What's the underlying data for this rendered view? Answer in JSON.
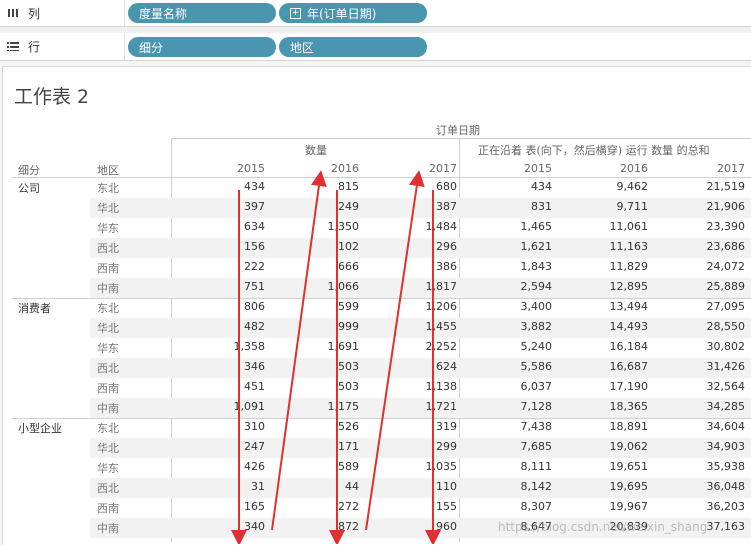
{
  "shelves": {
    "columns": {
      "label": "列",
      "icon": "columns-icon",
      "pills": [
        "度量名称",
        "年(订单日期)"
      ]
    },
    "rows": {
      "label": "行",
      "icon": "rows-icon",
      "pills": [
        "细分",
        "地区"
      ]
    }
  },
  "sheet": {
    "title": "工作表 2",
    "header_top": "订单日期",
    "measure_qty": "数量",
    "measure_running": "正在沿着 表(向下，然后横穿) 运行 数量 的总和",
    "row_headers": [
      "细分",
      "地区"
    ],
    "years": [
      "2015",
      "2016",
      "2017"
    ],
    "segments": [
      {
        "name": "公司",
        "rows": [
          {
            "region": "东北",
            "qty": [
              "434",
              "815",
              "680"
            ],
            "run": [
              "434",
              "9,462",
              "21,519"
            ]
          },
          {
            "region": "华北",
            "qty": [
              "397",
              "249",
              "387"
            ],
            "run": [
              "831",
              "9,711",
              "21,906"
            ]
          },
          {
            "region": "华东",
            "qty": [
              "634",
              "1,350",
              "1,484"
            ],
            "run": [
              "1,465",
              "11,061",
              "23,390"
            ]
          },
          {
            "region": "西北",
            "qty": [
              "156",
              "102",
              "296"
            ],
            "run": [
              "1,621",
              "11,163",
              "23,686"
            ]
          },
          {
            "region": "西南",
            "qty": [
              "222",
              "666",
              "386"
            ],
            "run": [
              "1,843",
              "11,829",
              "24,072"
            ]
          },
          {
            "region": "中南",
            "qty": [
              "751",
              "1,066",
              "1,817"
            ],
            "run": [
              "2,594",
              "12,895",
              "25,889"
            ]
          }
        ]
      },
      {
        "name": "消费者",
        "rows": [
          {
            "region": "东北",
            "qty": [
              "806",
              "599",
              "1,206"
            ],
            "run": [
              "3,400",
              "13,494",
              "27,095"
            ]
          },
          {
            "region": "华北",
            "qty": [
              "482",
              "999",
              "1,455"
            ],
            "run": [
              "3,882",
              "14,493",
              "28,550"
            ]
          },
          {
            "region": "华东",
            "qty": [
              "1,358",
              "1,691",
              "2,252"
            ],
            "run": [
              "5,240",
              "16,184",
              "30,802"
            ]
          },
          {
            "region": "西北",
            "qty": [
              "346",
              "503",
              "624"
            ],
            "run": [
              "5,586",
              "16,687",
              "31,426"
            ]
          },
          {
            "region": "西南",
            "qty": [
              "451",
              "503",
              "1,138"
            ],
            "run": [
              "6,037",
              "17,190",
              "32,564"
            ]
          },
          {
            "region": "中南",
            "qty": [
              "1,091",
              "1,175",
              "1,721"
            ],
            "run": [
              "7,128",
              "18,365",
              "34,285"
            ]
          }
        ]
      },
      {
        "name": "小型企业",
        "rows": [
          {
            "region": "东北",
            "qty": [
              "310",
              "526",
              "319"
            ],
            "run": [
              "7,438",
              "18,891",
              "34,604"
            ]
          },
          {
            "region": "华北",
            "qty": [
              "247",
              "171",
              "299"
            ],
            "run": [
              "7,685",
              "19,062",
              "34,903"
            ]
          },
          {
            "region": "华东",
            "qty": [
              "426",
              "589",
              "1,035"
            ],
            "run": [
              "8,111",
              "19,651",
              "35,938"
            ]
          },
          {
            "region": "西北",
            "qty": [
              "31",
              "44",
              "110"
            ],
            "run": [
              "8,142",
              "19,695",
              "36,048"
            ]
          },
          {
            "region": "西南",
            "qty": [
              "165",
              "272",
              "155"
            ],
            "run": [
              "8,307",
              "19,967",
              "36,203"
            ]
          },
          {
            "region": "中南",
            "qty": [
              "340",
              "872",
              "960"
            ],
            "run": [
              "8,647",
              "20,839",
              "37,163"
            ]
          }
        ]
      }
    ]
  },
  "watermark": "https://blog.csdn.net/weixin_shang",
  "colors": {
    "pill": "#4a95b0",
    "arrow": "#e03030"
  }
}
